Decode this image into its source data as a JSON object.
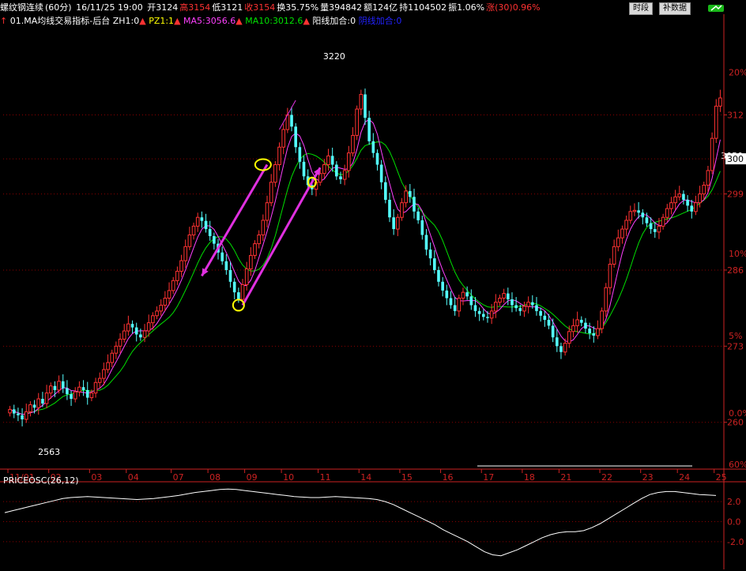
{
  "header": {
    "instrument": "螺纹钢连续",
    "period": "(60分)",
    "datetime": "16/11/25 19:00",
    "open": "开3124",
    "high": "高3154",
    "low": "低3121",
    "close": "收3154",
    "turnover": "换35.75%",
    "volume": "量394842",
    "amount": "额124亿",
    "open_interest": "持1104502",
    "amplitude": "振1.06%",
    "change": "涨(30)0.96%",
    "btn_time": "时段",
    "btn_fill": "补数据"
  },
  "indicator_line": {
    "name": "01.MA均线交易指标-后台",
    "zh": "ZH1:0",
    "pz": "PZ1:1",
    "ma5": "MA5:3056.6",
    "ma10": "MA10:3012.6",
    "yang": "阳线加合:0",
    "yin": "阴线加合:0"
  },
  "colors": {
    "up": "#ff3232",
    "down": "#54ffff",
    "ma5": "#ff40ff",
    "ma10": "#00e000",
    "grid": "#8b0000",
    "axis": "#cc2222",
    "osc": "#ffffff",
    "arrow": "#e030e0",
    "circle": "#ffff00"
  },
  "chart_data": {
    "type": "candlestick",
    "y_axis_labels": [
      {
        "value": 3125,
        "label": "312"
      },
      {
        "value": 3050,
        "label": "300"
      },
      {
        "value": 2990,
        "label": "299"
      },
      {
        "value": 2860,
        "label": "286"
      },
      {
        "value": 2730,
        "label": "273"
      },
      {
        "value": 2600,
        "label": "260"
      }
    ],
    "pct_labels": [
      {
        "value": 3190,
        "label": "20%"
      },
      {
        "value": 2880,
        "label": "10%"
      },
      {
        "value": 2740,
        "label": "5%"
      },
      {
        "value": 2608,
        "label": "0.0%"
      },
      {
        "value": 2520,
        "label": "60%"
      }
    ],
    "ylim": [
      2520,
      3270
    ],
    "x_ticks": [
      "11/01",
      "02",
      "03",
      "04",
      "07",
      "08",
      "09",
      "10",
      "11",
      "14",
      "15",
      "16",
      "17",
      "18",
      "21",
      "22",
      "23",
      "24",
      "25"
    ],
    "x_tick_index": [
      0,
      10,
      20,
      29,
      40,
      49,
      58,
      67,
      76,
      86,
      96,
      106,
      116,
      126,
      135,
      145,
      155,
      164,
      173
    ],
    "labels": [
      {
        "text": "3220",
        "index": 86,
        "value": 3220
      },
      {
        "text": "2563",
        "index": 3,
        "value": 2563
      },
      {
        "text": "3050",
        "index": 178,
        "value": 3050
      }
    ],
    "current_price": {
      "label": "300",
      "value": 3050
    },
    "closes": [
      2622,
      2615,
      2612,
      2605,
      2618,
      2630,
      2625,
      2640,
      2632,
      2650,
      2662,
      2655,
      2670,
      2658,
      2648,
      2640,
      2652,
      2660,
      2655,
      2642,
      2650,
      2668,
      2675,
      2690,
      2702,
      2718,
      2730,
      2742,
      2756,
      2768,
      2762,
      2750,
      2745,
      2756,
      2770,
      2782,
      2790,
      2800,
      2812,
      2825,
      2842,
      2858,
      2876,
      2900,
      2920,
      2935,
      2950,
      2944,
      2930,
      2918,
      2905,
      2890,
      2875,
      2860,
      2840,
      2822,
      2810,
      2835,
      2862,
      2885,
      2905,
      2920,
      2945,
      2975,
      3010,
      3040,
      3070,
      3100,
      3125,
      3105,
      3070,
      3045,
      3020,
      3005,
      2998,
      3010,
      3025,
      3040,
      3055,
      3040,
      3020,
      3015,
      3030,
      3060,
      3090,
      3135,
      3160,
      3120,
      3080,
      3060,
      3040,
      3010,
      2980,
      2950,
      2930,
      2950,
      2975,
      2995,
      2985,
      2960,
      2945,
      2920,
      2895,
      2880,
      2860,
      2840,
      2825,
      2812,
      2800,
      2790,
      2812,
      2822,
      2815,
      2800,
      2790,
      2785,
      2780,
      2778,
      2790,
      2805,
      2812,
      2820,
      2810,
      2800,
      2795,
      2790,
      2798,
      2805,
      2800,
      2790,
      2782,
      2775,
      2765,
      2745,
      2730,
      2720,
      2735,
      2755,
      2765,
      2775,
      2770,
      2760,
      2752,
      2748,
      2760,
      2790,
      2830,
      2870,
      2900,
      2915,
      2930,
      2945,
      2960,
      2962,
      2958,
      2950,
      2940,
      2930,
      2925,
      2935,
      2950,
      2965,
      2975,
      2985,
      2990,
      2980,
      2970,
      2960,
      2975,
      2990,
      3005,
      3030,
      3085,
      3140,
      3154
    ],
    "osc_ylim": [
      -3.5,
      3.5
    ],
    "osc_ticks": [
      2.0,
      0.0,
      -2.0
    ],
    "osc_name": "PRICEOSC(26,12)",
    "osc_values": [
      0.9,
      1.1,
      1.3,
      1.5,
      1.7,
      1.9,
      2.1,
      2.3,
      2.4,
      2.45,
      2.5,
      2.45,
      2.4,
      2.35,
      2.3,
      2.25,
      2.2,
      2.25,
      2.3,
      2.4,
      2.5,
      2.6,
      2.75,
      2.9,
      3.0,
      3.1,
      3.2,
      3.25,
      3.2,
      3.1,
      3.0,
      2.9,
      2.8,
      2.7,
      2.6,
      2.5,
      2.45,
      2.4,
      2.4,
      2.45,
      2.5,
      2.45,
      2.4,
      2.35,
      2.3,
      2.2,
      2.0,
      1.7,
      1.3,
      0.9,
      0.5,
      0.1,
      -0.3,
      -0.8,
      -1.2,
      -1.6,
      -2.0,
      -2.5,
      -3.0,
      -3.3,
      -3.4,
      -3.1,
      -2.8,
      -2.4,
      -2.0,
      -1.6,
      -1.3,
      -1.1,
      -1.0,
      -1.0,
      -0.9,
      -0.6,
      -0.2,
      0.3,
      0.8,
      1.3,
      1.8,
      2.3,
      2.7,
      2.9,
      3.0,
      3.0,
      2.9,
      2.8,
      2.7,
      2.65,
      2.6
    ]
  }
}
